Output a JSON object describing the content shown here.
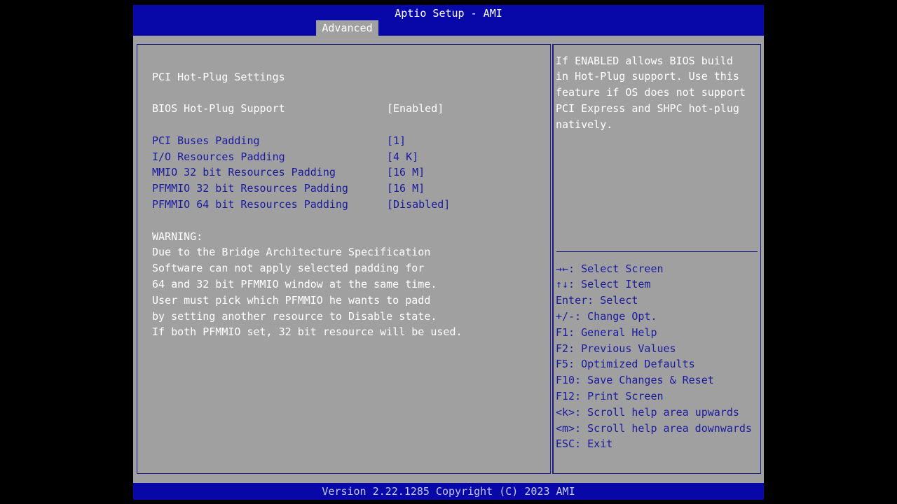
{
  "header": {
    "title": "Aptio Setup - AMI",
    "active_tab": "Advanced"
  },
  "main": {
    "section_title": "PCI Hot-Plug Settings",
    "settings": [
      {
        "label": "BIOS Hot-Plug Support",
        "value": "[Enabled]",
        "selected": true
      },
      {
        "label": "PCI Buses Padding",
        "value": "[1]"
      },
      {
        "label": "I/O Resources Padding",
        "value": "[4 K]"
      },
      {
        "label": "MMIO 32 bit Resources Padding",
        "value": "[16 M]"
      },
      {
        "label": "PFMMIO 32 bit Resources Padding",
        "value": "[16 M]"
      },
      {
        "label": "PFMMIO 64 bit Resources Padding",
        "value": "[Disabled]"
      }
    ],
    "warning": [
      "WARNING:",
      "Due to the Bridge Architecture Specification",
      "Software can not apply selected padding for",
      "64 and 32 bit PFMMIO window at the same time.",
      "User must pick which PFMMIO he wants to padd",
      "by setting another resource to Disable state.",
      "If both PFMMIO set, 32 bit resource will be used."
    ]
  },
  "help": {
    "text": [
      "If ENABLED allows BIOS build",
      "in Hot-Plug support. Use this",
      "feature if OS does not support",
      "PCI Express and SHPC hot-plug",
      "natively."
    ],
    "keys": [
      "→←: Select Screen",
      "↑↓: Select Item",
      "Enter: Select",
      "+/-: Change Opt.",
      "F1: General Help",
      "F2: Previous Values",
      "F5: Optimized Defaults",
      "F10: Save Changes & Reset",
      "F12: Print Screen",
      "<k>: Scroll help area upwards",
      "<m>: Scroll help area downwards",
      "ESC: Exit"
    ]
  },
  "footer": {
    "text": "Version 2.22.1285 Copyright (C) 2023 AMI"
  },
  "colors": {
    "bar_blue": "#0808a8",
    "panel_gray": "#a0a0a0",
    "item_blue": "#1a1aa0"
  }
}
